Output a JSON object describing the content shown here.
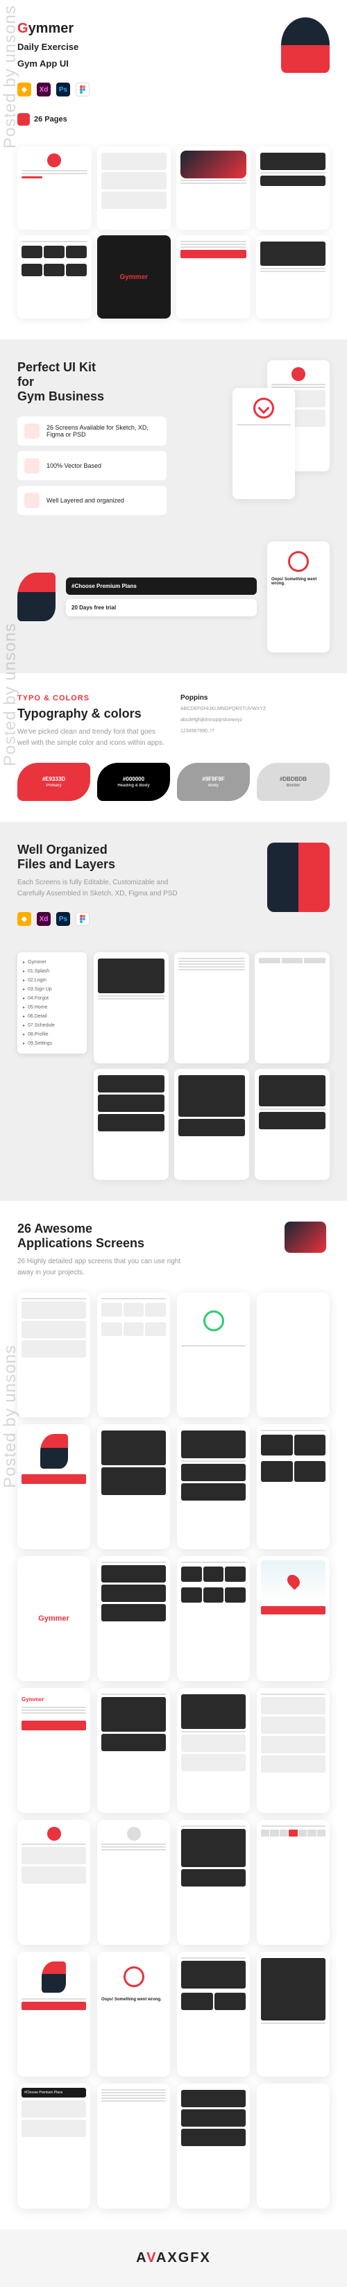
{
  "brand": {
    "name_g": "G",
    "name_rest": "ymmer"
  },
  "hero": {
    "subtitle_l1": "Daily Exercise",
    "subtitle_l2": "Gym App UI",
    "pages_count": "26 Pages"
  },
  "section2": {
    "title_l1": "Perfect UI Kit",
    "title_l2": "for",
    "title_l3": "Gym Business",
    "features": [
      "26 Screens Available for Sketch, XD, Figma or PSD",
      "100% Vector Based",
      "Well Layered and organized"
    ],
    "promo1": "#Choose Premium Plans",
    "promo2": "20 Days free trial"
  },
  "typo": {
    "eyebrow": "TYPO & COLORS",
    "title": "Typography & colors",
    "desc": "We've picked clean and trendy font that goes well with the simple color and icons within apps.",
    "font_name": "Poppins",
    "font_sample_upper": "ABCDEFGHIJKLMNOPQRSTUVWXYZ",
    "font_sample_lower": "abcdefghijklmnopqrstuvwxyz",
    "font_sample_num": "1234567890..!?",
    "swatches": [
      {
        "hex": "#E9333D",
        "label": "Primary"
      },
      {
        "hex": "#000000",
        "label": "Heading & Body"
      },
      {
        "hex": "#9F9F9F",
        "label": "Body"
      },
      {
        "hex": "#DBDBDB",
        "label": "Border"
      }
    ]
  },
  "organized": {
    "title_l1": "Well Organized",
    "title_l2": "Files and Layers",
    "desc": "Each Screens is fully Editable, Customizable and Carefully Assembled in Sketch, XD, Figma and PSD",
    "layers": [
      "Gymmer",
      "01.Splash",
      "02.Login",
      "03.Sign Up",
      "04.Forgot",
      "05.Home",
      "06.Detail",
      "07.Schedule",
      "08.Profile",
      "09.Settings"
    ]
  },
  "awesome": {
    "title_l1": "26 Awesome",
    "title_l2": "Applications Screens",
    "desc": "26 Highly detailed app screens that you can use right away in your projects."
  },
  "watermark": "Posted by unsons",
  "footer": {
    "a": "A",
    "v": "V",
    "rest": "AXGFX"
  }
}
